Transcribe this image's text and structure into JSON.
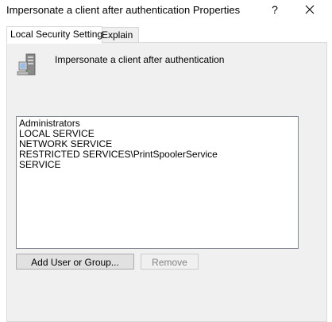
{
  "window": {
    "title": "Impersonate a client after authentication Properties",
    "help_label": "?",
    "close_icon": "close-icon"
  },
  "tabs": [
    {
      "label": "Local Security Setting",
      "active": true
    },
    {
      "label": "Explain",
      "active": false
    }
  ],
  "policy": {
    "icon": "server-icon",
    "name": "Impersonate a client after authentication"
  },
  "accounts": [
    "Administrators",
    "LOCAL SERVICE",
    "NETWORK SERVICE",
    "RESTRICTED SERVICES\\PrintSpoolerService",
    "SERVICE"
  ],
  "buttons": {
    "add_label": "Add User or Group...",
    "remove_label": "Remove",
    "remove_enabled": false
  }
}
